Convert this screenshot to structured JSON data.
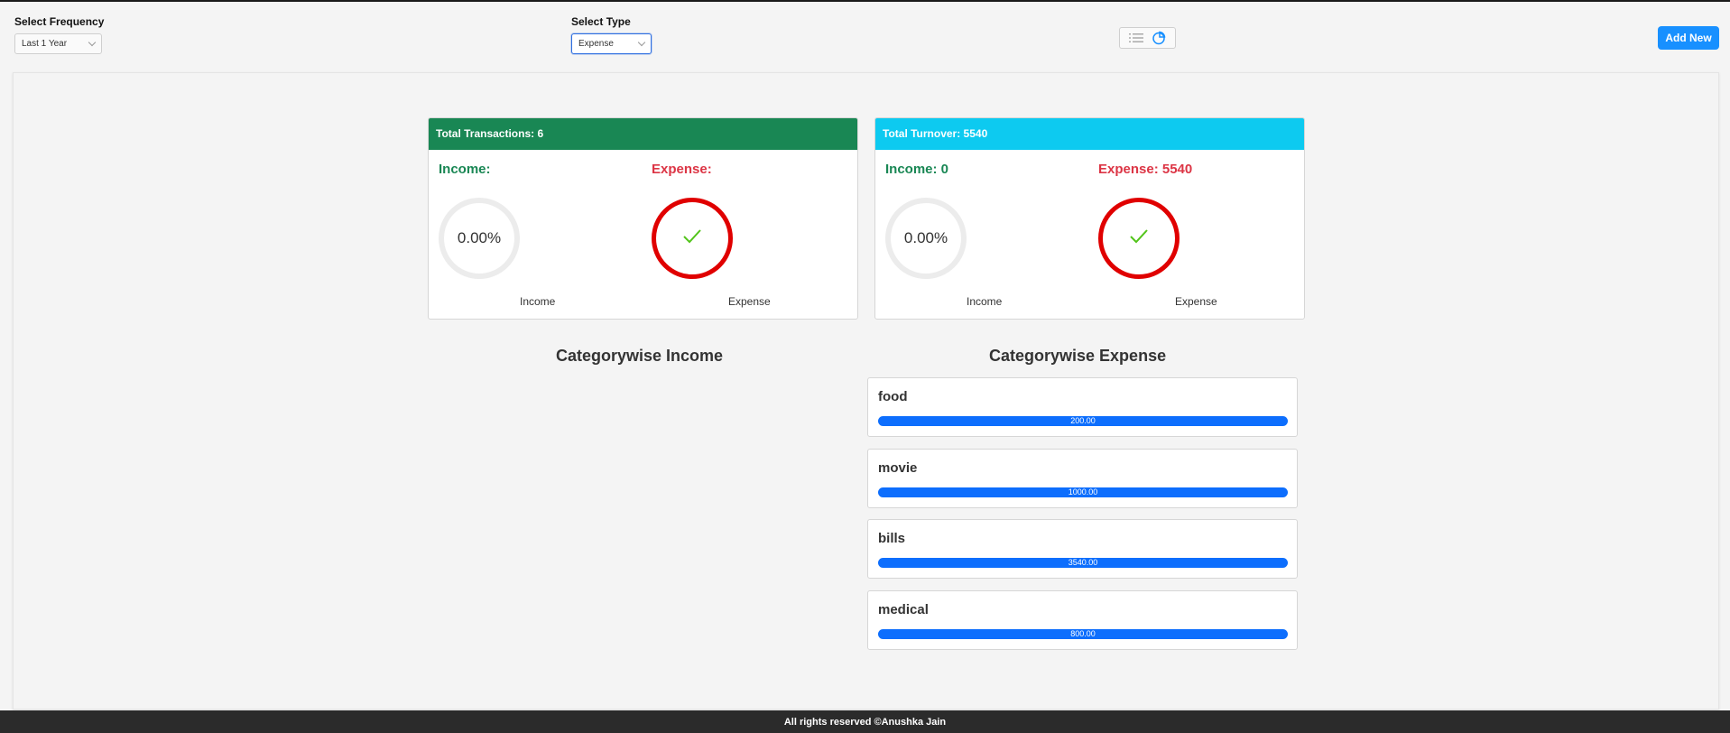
{
  "filters": {
    "frequency": {
      "label": "Select Frequency",
      "value": "Last 1 Year"
    },
    "type": {
      "label": "Select Type",
      "value": "Expense"
    }
  },
  "view_toggle": {
    "icons": [
      "list-icon",
      "pie-chart-icon"
    ],
    "active": "pie-chart-icon",
    "accent": "#1890ff"
  },
  "add_button": {
    "label": "Add New"
  },
  "transactions_card": {
    "header": "Total Transactions: 6",
    "header_color": "#198754",
    "income": {
      "title": "Income:",
      "percent_text": "0.00%",
      "caption": "Income"
    },
    "expense": {
      "title": "Expense:",
      "caption": "Expense",
      "status": "check-icon"
    }
  },
  "turnover_card": {
    "header": "Total Turnover: 5540",
    "header_color": "#0dcaf0",
    "income": {
      "title": "Income: 0",
      "percent_text": "0.00%",
      "caption": "Income"
    },
    "expense": {
      "title": "Expense: 5540",
      "caption": "Expense",
      "status": "check-icon"
    }
  },
  "categorywise_income": {
    "title": "Categorywise Income",
    "items": []
  },
  "categorywise_expense": {
    "title": "Categorywise Expense",
    "items": [
      {
        "name": "food",
        "value_text": "200.00",
        "progress_percent": 100
      },
      {
        "name": "movie",
        "value_text": "1000.00",
        "progress_percent": 100
      },
      {
        "name": "bills",
        "value_text": "3540.00",
        "progress_percent": 100
      },
      {
        "name": "medical",
        "value_text": "800.00",
        "progress_percent": 100
      }
    ]
  },
  "footer": {
    "text": "All rights reserved ©Anushka Jain"
  },
  "colors": {
    "income": "#198754",
    "expense": "#dc3545",
    "progress": "#0d6efd",
    "ring_expense": "#e00000",
    "check": "#52c41a"
  }
}
